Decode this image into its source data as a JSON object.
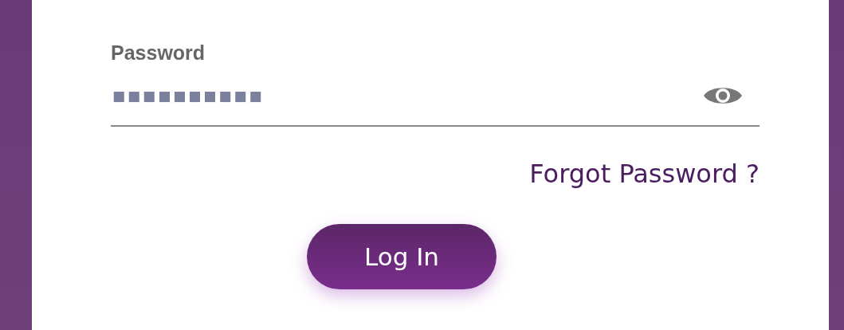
{
  "password": {
    "label": "Password",
    "value": "■■■■■■■■■■"
  },
  "forgot_link": "Forgot Password ?",
  "login_button": "Log In"
}
